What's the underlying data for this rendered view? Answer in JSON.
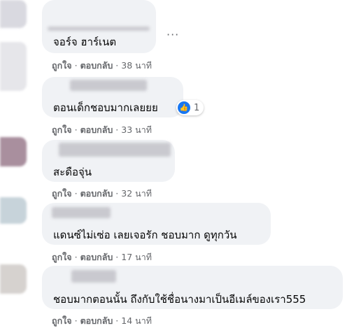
{
  "comments": [
    {
      "text": "จอร์จ ฮาร์เนต",
      "time": "38 นาที"
    },
    {
      "text": "ตอนเด็กชอบมากเลยยย",
      "time": "33 นาที",
      "reaction_count": "1"
    },
    {
      "text": "สะดือจุ่น",
      "time": "32 นาที"
    },
    {
      "text": "แดนซ์ไม่เซ่อ เลยเจอรัก ชอบมาก ดูทุกวัน",
      "time": "17 นาที"
    },
    {
      "text": "ชอบมากตอนนั้น ถึงกับใช้ชื่อนางมาเป็นอีเมล์ของเรา555",
      "time": "14 นาที"
    }
  ],
  "actions": {
    "like": "ถูกใจ",
    "reply": "ตอบกลับ",
    "separator": "·"
  },
  "more_options": "···",
  "colors": {
    "bubble": "#f0f2f5",
    "meta_text": "#65676b",
    "like_blue": "#1877f2"
  },
  "icons": {
    "like": "thumbs-up-icon"
  }
}
